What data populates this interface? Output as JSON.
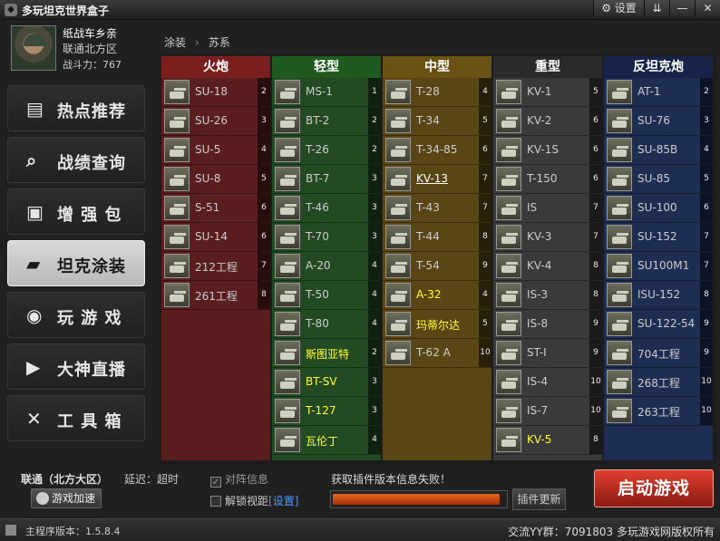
{
  "window": {
    "title": "多玩坦克世界盒子",
    "settings_label": "设置",
    "menu_symbol": "⇊",
    "minimize_symbol": "—",
    "close_symbol": "✕"
  },
  "profile": {
    "name": "纸战车乡亲",
    "server": "联通北方区",
    "power": "战斗力：767"
  },
  "nav": [
    {
      "label": "热点推荐",
      "icon": "news-icon",
      "active": false
    },
    {
      "label": "战绩查询",
      "icon": "search-icon",
      "active": false
    },
    {
      "label": "增 强 包",
      "icon": "briefcase-icon",
      "active": false
    },
    {
      "label": "坦克涂装",
      "icon": "tank-icon",
      "active": true
    },
    {
      "label": "玩 游 戏",
      "icon": "gamepad-icon",
      "active": false
    },
    {
      "label": "大神直播",
      "icon": "play-icon",
      "active": false
    },
    {
      "label": "工 具 箱",
      "icon": "tools-icon",
      "active": false
    }
  ],
  "breadcrumb": {
    "root": "涂装",
    "current": "苏系"
  },
  "columns": [
    {
      "title": "火炮",
      "bg": "#5a1e1e",
      "head": "#7a1e1e",
      "tanks": [
        {
          "name": "SU-18",
          "tier": "2"
        },
        {
          "name": "SU-26",
          "tier": "3"
        },
        {
          "name": "SU-5",
          "tier": "4"
        },
        {
          "name": "SU-8",
          "tier": "5"
        },
        {
          "name": "S-51",
          "tier": "6"
        },
        {
          "name": "SU-14",
          "tier": "6"
        },
        {
          "name": "212工程",
          "tier": "7"
        },
        {
          "name": "261工程",
          "tier": "8"
        }
      ]
    },
    {
      "title": "轻型",
      "bg": "#234a23",
      "head": "#1f5a1f",
      "tanks": [
        {
          "name": "MS-1",
          "tier": "1"
        },
        {
          "name": "BT-2",
          "tier": "2"
        },
        {
          "name": "T-26",
          "tier": "2"
        },
        {
          "name": "BT-7",
          "tier": "3"
        },
        {
          "name": "T-46",
          "tier": "3"
        },
        {
          "name": "T-70",
          "tier": "3"
        },
        {
          "name": "A-20",
          "tier": "4"
        },
        {
          "name": "T-50",
          "tier": "4"
        },
        {
          "name": "T-80",
          "tier": "4"
        },
        {
          "name": "斯图亚特",
          "tier": "2",
          "style": "hl"
        },
        {
          "name": "BT-SV",
          "tier": "3",
          "style": "hl"
        },
        {
          "name": "T-127",
          "tier": "3",
          "style": "hl"
        },
        {
          "name": "瓦伦丁",
          "tier": "4",
          "style": "hl"
        }
      ]
    },
    {
      "title": "中型",
      "bg": "#5a4614",
      "head": "#6a5214",
      "tanks": [
        {
          "name": "T-28",
          "tier": "4"
        },
        {
          "name": "T-34",
          "tier": "5"
        },
        {
          "name": "T-34-85",
          "tier": "6"
        },
        {
          "name": "KV-13",
          "tier": "7",
          "style": "ul"
        },
        {
          "name": "T-43",
          "tier": "7"
        },
        {
          "name": "T-44",
          "tier": "8"
        },
        {
          "name": "T-54",
          "tier": "9"
        },
        {
          "name": "A-32",
          "tier": "4",
          "style": "hl"
        },
        {
          "name": "玛蒂尔达",
          "tier": "5",
          "style": "hl"
        },
        {
          "name": "T-62 A",
          "tier": "10"
        }
      ]
    },
    {
      "title": "重型",
      "bg": "#3a3a3a",
      "head": "#2a2a2a",
      "tanks": [
        {
          "name": "KV-1",
          "tier": "5"
        },
        {
          "name": "KV-2",
          "tier": "6"
        },
        {
          "name": "KV-1S",
          "tier": "6"
        },
        {
          "name": "T-150",
          "tier": "6"
        },
        {
          "name": "IS",
          "tier": "7"
        },
        {
          "name": "KV-3",
          "tier": "7"
        },
        {
          "name": "KV-4",
          "tier": "8"
        },
        {
          "name": "IS-3",
          "tier": "8"
        },
        {
          "name": "IS-8",
          "tier": "9"
        },
        {
          "name": "ST-I",
          "tier": "9"
        },
        {
          "name": "IS-4",
          "tier": "10"
        },
        {
          "name": "IS-7",
          "tier": "10"
        },
        {
          "name": "KV-5",
          "tier": "8",
          "style": "hl"
        }
      ]
    },
    {
      "title": "反坦克炮",
      "bg": "#1e2e52",
      "head": "#16244a",
      "tanks": [
        {
          "name": "AT-1",
          "tier": "2"
        },
        {
          "name": "SU-76",
          "tier": "3"
        },
        {
          "name": "SU-85B",
          "tier": "4"
        },
        {
          "name": "SU-85",
          "tier": "5"
        },
        {
          "name": "SU-100",
          "tier": "6"
        },
        {
          "name": "SU-152",
          "tier": "7"
        },
        {
          "name": "SU100M1",
          "tier": "7"
        },
        {
          "name": "ISU-152",
          "tier": "8"
        },
        {
          "name": "SU-122-54",
          "tier": "9"
        },
        {
          "name": "704工程",
          "tier": "9"
        },
        {
          "name": "268工程",
          "tier": "10"
        },
        {
          "name": "263工程",
          "tier": "10"
        }
      ]
    }
  ],
  "bottom": {
    "region": "联通（北方大区）",
    "latency": "延迟：超时",
    "accel_label": "游戏加速",
    "check1_label": "对阵信息",
    "check1_checked": true,
    "check2_label": "解锁视距",
    "check2_link": "[设置]",
    "check2_checked": false,
    "plugin_status": "获取插件版本信息失败！",
    "progress": 0.97,
    "update_label": "插件更新",
    "launch_label": "启动游戏"
  },
  "status": {
    "version": "主程序版本：1.5.8.4",
    "footer": "交流YY群：7091803 多玩游戏网版权所有"
  },
  "colors": {
    "launch": "#c8281a",
    "progress": "#e0601a",
    "highlight_text": "#ffff3a"
  }
}
